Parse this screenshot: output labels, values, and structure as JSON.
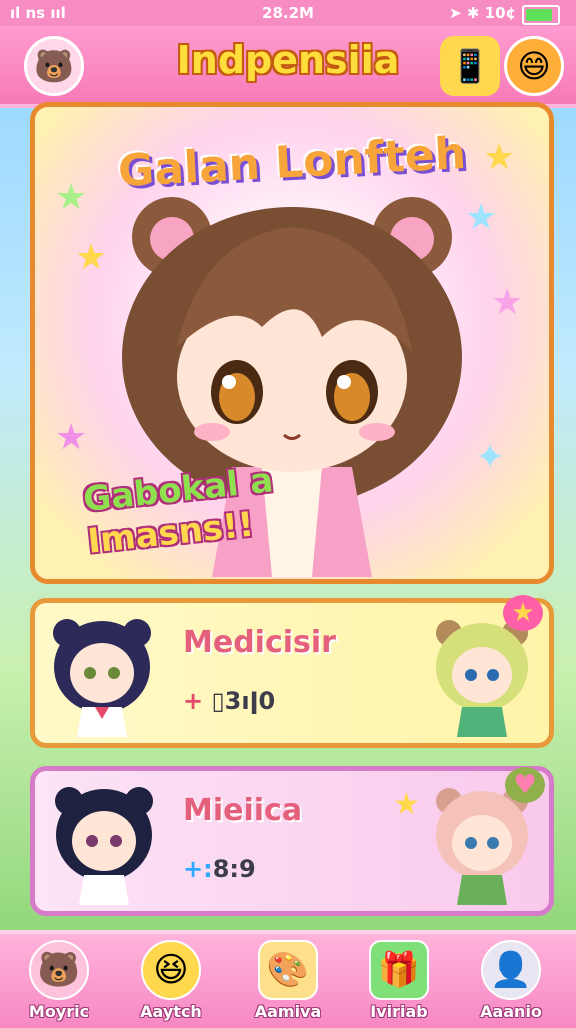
{
  "status_bar": {
    "left": "ıl ns ııl",
    "time": "28.2M",
    "right": "➤ ✱ 10¢"
  },
  "header": {
    "title": "Indpensiia",
    "left_icon": "bear-face-icon",
    "right_icon1": "phone-icon",
    "right_icon2": "smile-face-icon"
  },
  "main_card": {
    "title": "Galan Lonfteh",
    "slogan_line1": "Gabokal a",
    "slogan_line2": "Imasns!!"
  },
  "list_cards": [
    {
      "name": "Medicisir",
      "stat": "▯3ıǀ0",
      "stat_prefix": "+ ",
      "color": "#fff4a8"
    },
    {
      "name": "Mieiica",
      "stat": "8:9",
      "stat_prefix": "+:",
      "color": "#f9c9ec"
    }
  ],
  "nav": {
    "items": [
      {
        "label": "Moyric",
        "icon": "bear-icon"
      },
      {
        "label": "Aaytch",
        "icon": "happy-face-icon"
      },
      {
        "label": "Aamiva",
        "icon": "brush-palette-icon"
      },
      {
        "label": "Iviriab",
        "icon": "gift-box-icon"
      },
      {
        "label": "Aaanio",
        "icon": "profile-icon"
      }
    ]
  }
}
